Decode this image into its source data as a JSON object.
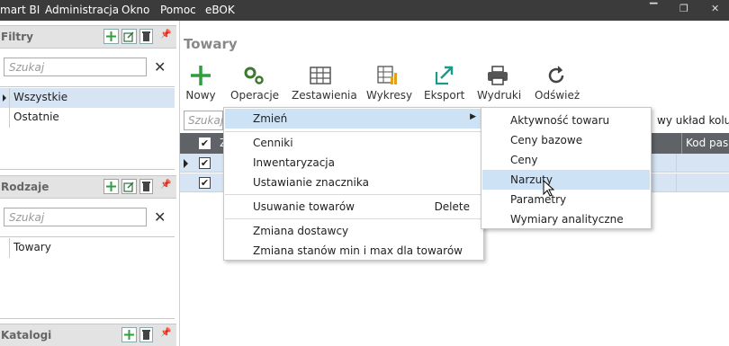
{
  "menubar": {
    "items": [
      "mart BI",
      "Administracja",
      "Okno",
      "Pomoc",
      "eBOK"
    ],
    "window_controls": [
      "▔",
      "❐",
      "✕"
    ]
  },
  "filters": {
    "title": "Filtry",
    "search_placeholder": "Szukaj",
    "items": [
      "Wszystkie",
      "Ostatnie"
    ]
  },
  "types": {
    "title": "Rodzaje",
    "search_placeholder": "Szukaj",
    "items": [
      "Towary"
    ]
  },
  "catalogs": {
    "title": "Katalogi"
  },
  "main": {
    "title": "Towary",
    "toolbar": [
      {
        "label": "Nowy",
        "icon": "plus-icon"
      },
      {
        "label": "Operacje",
        "icon": "gears-icon"
      },
      {
        "label": "Zestawienia",
        "icon": "table-icon"
      },
      {
        "label": "Wykresy",
        "icon": "chart-icon"
      },
      {
        "label": "Eksport",
        "icon": "export-icon"
      },
      {
        "label": "Wydruki",
        "icon": "printer-icon"
      },
      {
        "label": "Odśwież",
        "icon": "refresh-icon"
      }
    ],
    "search_placeholder": "Szukaj",
    "layout_link": "wy układ kolumn",
    "grid": {
      "columns": [
        "Z",
        "Kod pasko"
      ]
    }
  },
  "context_menu": {
    "items": [
      {
        "label": "Zmień",
        "has_submenu": true
      },
      {
        "label": "Cenniki"
      },
      {
        "label": "Inwentaryzacja"
      },
      {
        "label": "Ustawianie znacznika"
      },
      {
        "label": "Usuwanie towarów",
        "shortcut": "Delete"
      },
      {
        "label": "Zmiana dostawcy"
      },
      {
        "label": "Zmiana stanów min i max dla towarów"
      }
    ]
  },
  "submenu": {
    "items": [
      "Aktywność towaru",
      "Ceny bazowe",
      "Ceny",
      "Narzuty",
      "Parametry",
      "Wymiary analityczne"
    ],
    "highlighted": "Narzuty"
  },
  "colors": {
    "accent_green": "#2e9e3e",
    "highlight": "#cde2f5",
    "grid_header": "#5f6368"
  }
}
